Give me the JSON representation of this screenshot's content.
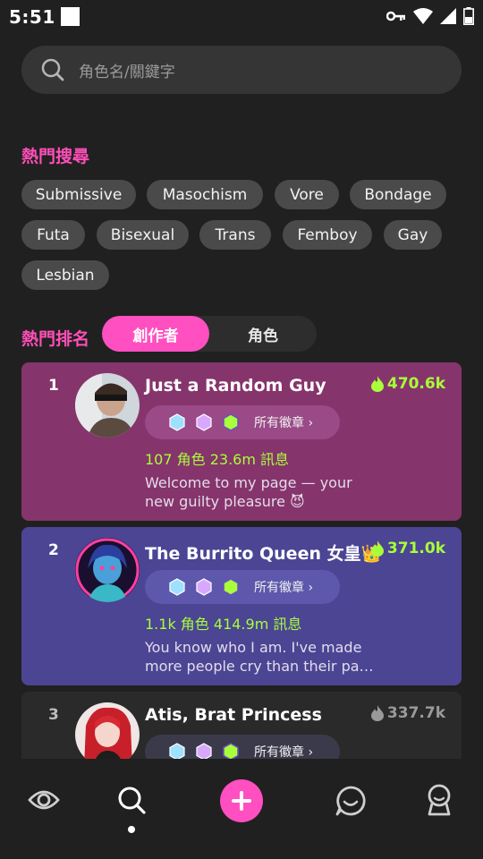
{
  "status_bar": {
    "time": "5:51"
  },
  "search": {
    "placeholder": "角色名/關鍵字"
  },
  "hot_search": {
    "title": "熱門搜尋",
    "tags": [
      "Submissive",
      "Masochism",
      "Vore",
      "Bondage",
      "Futa",
      "Bisexual",
      "Trans",
      "Femboy",
      "Gay",
      "Lesbian"
    ]
  },
  "ranking": {
    "title": "熱門排名",
    "tabs": [
      {
        "label": "創作者",
        "active": true
      },
      {
        "label": "角色",
        "active": false
      }
    ],
    "badges_label": "所有徽章 ›",
    "cards": [
      {
        "rank": "1",
        "name": "Just  a Random Guy",
        "score": "470.6k",
        "stats": "107 角色  23.6m 訊息",
        "bio": "Welcome to my page — your new guilty pleasure 😈",
        "bg": "#86346c",
        "badge_bg": "#9a4a86"
      },
      {
        "rank": "2",
        "name": "The Burrito Queen 女皇👑",
        "score": "371.0k",
        "stats": "1.1k 角色  414.9m 訊息",
        "bio": "You know who I am. I've made more people cry than their pa…",
        "bg": "#4b4594",
        "badge_bg": "#5d58ac"
      },
      {
        "rank": "3",
        "name": "Atis, Brat Princess",
        "score": "337.7k",
        "stats": "",
        "bio": "",
        "bg": "#2a2a2a",
        "badge_bg": "#3a3a4a"
      }
    ]
  },
  "colors": {
    "accent": "#ff4fc0",
    "highlight": "#a8ff3a",
    "title": "#ff4fb8"
  },
  "bottom_nav": [
    "eye-icon",
    "search-icon",
    "add-icon",
    "chat-icon",
    "profile-icon"
  ]
}
